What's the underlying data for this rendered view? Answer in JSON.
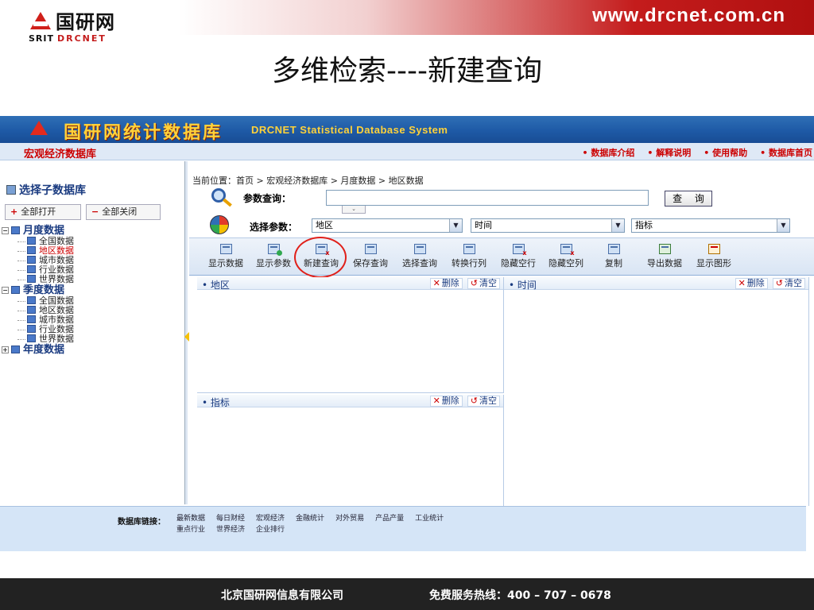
{
  "slide": {
    "logo_cn": "国研网",
    "logo_sub_a": "SRIT",
    "logo_sub_b": "DRCNET",
    "url": "www.drcnet.com.cn",
    "title": "多维检索----新建查询",
    "footer_company": "北京国研网信息有限公司",
    "footer_hotline": "免费服务热线：400 – 707 – 0678"
  },
  "app": {
    "title_cn": "国研网统计数据库",
    "title_en": "DRCNET Statistical Database System",
    "section_title": "宏观经济数据库",
    "top_links": [
      "数据库介绍",
      "解释说明",
      "使用帮助",
      "数据库首页"
    ]
  },
  "sidebar": {
    "select_title": "选择子数据库",
    "expand_all": "全部打开",
    "collapse_all": "全部关闭",
    "groups": [
      {
        "label": "月度数据",
        "items": [
          "全国数据",
          "地区数据",
          "城市数据",
          "行业数据",
          "世界数据"
        ]
      },
      {
        "label": "季度数据",
        "items": [
          "全国数据",
          "地区数据",
          "城市数据",
          "行业数据",
          "世界数据"
        ]
      },
      {
        "label": "年度数据",
        "items": []
      }
    ]
  },
  "main": {
    "breadcrumb": "当前位置：首页 > 宏观经济数据库 > 月度数据 > 地区数据",
    "query_label": "参数查询：",
    "query_value": "",
    "query_button": "查 询",
    "param_label": "选择参数：",
    "selects": [
      "地区",
      "时间",
      "指标"
    ],
    "toolbar": [
      "显示数据",
      "显示参数",
      "新建查询",
      "保存查询",
      "选择查询",
      "转换行列",
      "隐藏空行",
      "隐藏空列",
      "复制",
      "导出数据",
      "显示图形"
    ],
    "panels": {
      "region": "地区",
      "time": "时间",
      "indicator": "指标",
      "delete_label": "删除",
      "clear_label": "清空"
    }
  },
  "footer": {
    "links_label": "数据库链接：",
    "links_row1": [
      "最新数据",
      "每日财经",
      "宏观经济",
      "金融统计",
      "对外贸易",
      "产品产量",
      "工业统计"
    ],
    "links_row2": [
      "重点行业",
      "世界经济",
      "企业排行"
    ]
  },
  "colors": {
    "brand_red": "#c41c1c",
    "app_blue": "#1e5aa6",
    "title_yellow": "#ffd23a",
    "highlight_ring": "#e0201a"
  }
}
